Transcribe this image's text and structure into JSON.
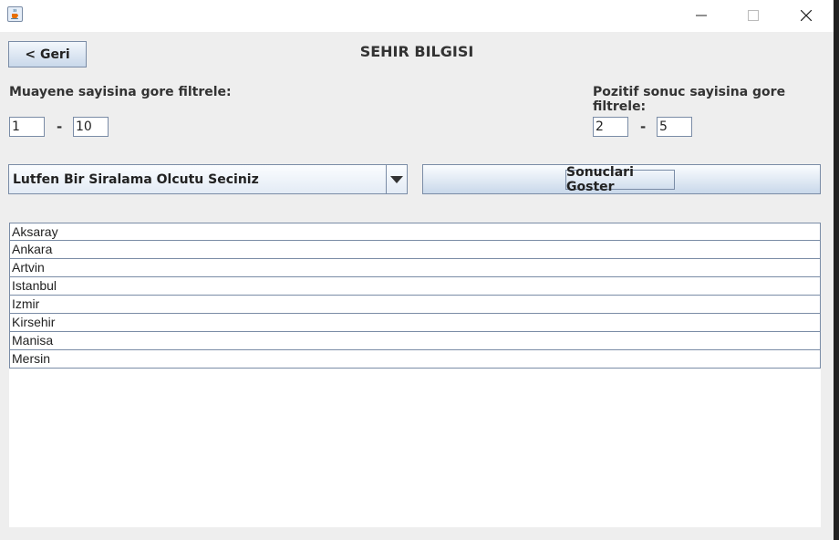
{
  "window": {
    "icon": "java-cup-icon",
    "controls": [
      "minimize-icon",
      "maximize-icon",
      "close-icon"
    ]
  },
  "header": {
    "back_label": "< Geri",
    "title": "SEHIR BILGISI"
  },
  "filters": {
    "exam_label": "Muayene sayisina gore filtrele:",
    "exam_min": "1",
    "exam_max": "10",
    "positive_label": "Pozitif sonuc sayisina gore filtrele:",
    "positive_min": "2",
    "positive_max": "5",
    "separator": "-"
  },
  "sort": {
    "selected": "Lutfen Bir Siralama Olcutu Seciniz"
  },
  "actions": {
    "show_label": "Sonuclari Goster"
  },
  "results": {
    "cities": [
      "Aksaray",
      "Ankara",
      "Artvin",
      "Istanbul",
      "Izmir",
      "Kirsehir",
      "Manisa",
      "Mersin"
    ]
  }
}
